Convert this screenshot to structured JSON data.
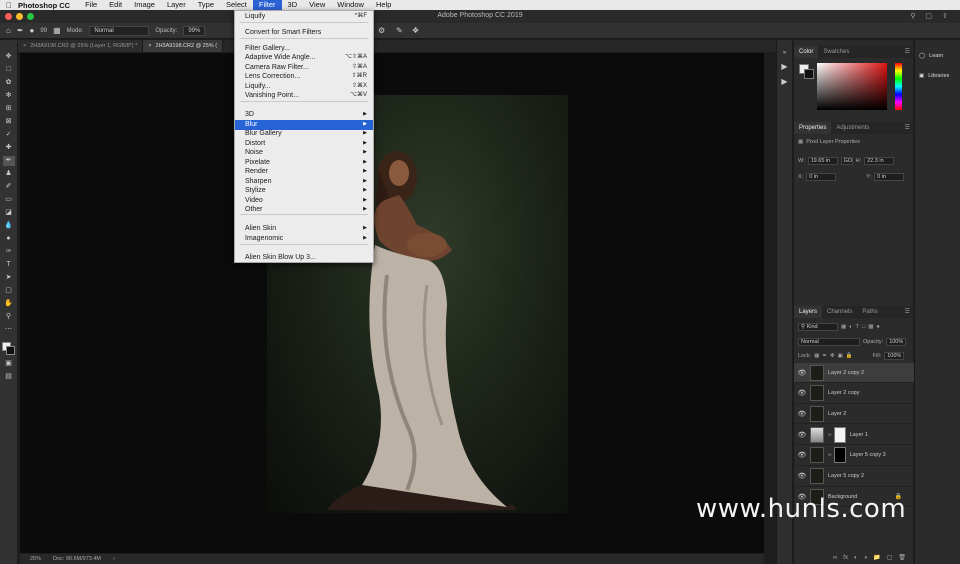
{
  "menubar": {
    "app_name": "Photoshop CC",
    "items": [
      "File",
      "Edit",
      "Image",
      "Layer",
      "Type",
      "Select",
      "Filter",
      "3D",
      "View",
      "Window",
      "Help"
    ],
    "active_item": "Filter"
  },
  "window": {
    "title": "Adobe Photoshop CC 2019"
  },
  "options_bar": {
    "brush_size": "99",
    "mode_label": "Mode:",
    "mode_value": "Normal",
    "opacity_label": "Opacity:",
    "opacity_value": "99%"
  },
  "doc_tabs": [
    {
      "label": "2H3A9196.CR2 @ 25% (Layer 1, RGB/8*) *",
      "active": false
    },
    {
      "label": "2H3A9198.CR2 @ 25% (",
      "active": true
    }
  ],
  "filter_menu": {
    "items": [
      {
        "label": "Liquify",
        "shortcut": "^⌘F"
      },
      {
        "label": "Convert for Smart Filters",
        "shortcut": ""
      },
      {
        "label": "Filter Gallery...",
        "shortcut": ""
      },
      {
        "label": "Adaptive Wide Angle...",
        "shortcut": "⌥⇧⌘A"
      },
      {
        "label": "Camera Raw Filter...",
        "shortcut": "⇧⌘A"
      },
      {
        "label": "Lens Correction...",
        "shortcut": "⇧⌘R"
      },
      {
        "label": "Liquify...",
        "shortcut": "⇧⌘X"
      },
      {
        "label": "Vanishing Point...",
        "shortcut": "⌥⌘V"
      },
      {
        "label": "3D",
        "submenu": true
      },
      {
        "label": "Blur",
        "submenu": true,
        "highlighted": true
      },
      {
        "label": "Blur Gallery",
        "submenu": true
      },
      {
        "label": "Distort",
        "submenu": true
      },
      {
        "label": "Noise",
        "submenu": true
      },
      {
        "label": "Pixelate",
        "submenu": true
      },
      {
        "label": "Render",
        "submenu": true
      },
      {
        "label": "Sharpen",
        "submenu": true
      },
      {
        "label": "Stylize",
        "submenu": true
      },
      {
        "label": "Video",
        "submenu": true
      },
      {
        "label": "Other",
        "submenu": true
      },
      {
        "label": "Alien Skin",
        "submenu": true
      },
      {
        "label": "Imagenomic",
        "submenu": true
      },
      {
        "label": "Alien Skin Blow Up 3...",
        "shortcut": ""
      }
    ],
    "submenu_arrow": "▶"
  },
  "color_panel": {
    "tabs": [
      "Color",
      "Swatches"
    ]
  },
  "properties_panel": {
    "tabs": [
      "Properties",
      "Adjustments"
    ],
    "section_title": "Pixel Layer Properties",
    "w_label": "W:",
    "w_value": "19.65 in",
    "h_label": "H:",
    "h_value": "22.3 in",
    "x_label": "X:",
    "x_value": "0 in",
    "y_label": "Y:",
    "y_value": "0 in",
    "link_label": "GO"
  },
  "layers_panel": {
    "tabs": [
      "Layers",
      "Channels",
      "Paths"
    ],
    "kind_label": "Kind",
    "blend_mode": "Normal",
    "opacity_label": "Opacity:",
    "opacity_value": "100%",
    "lock_label": "Lock:",
    "fill_label": "Fill:",
    "fill_value": "100%",
    "layers": [
      {
        "name": "Layer 2 copy 2",
        "active": true
      },
      {
        "name": "Layer 2 copy"
      },
      {
        "name": "Layer 2"
      },
      {
        "name": "Layer 1"
      },
      {
        "name": "Layer 5 copy 3"
      },
      {
        "name": "Layer 5 copy 2"
      },
      {
        "name": "Background"
      }
    ]
  },
  "learn_panel": {
    "learn_label": "Learn",
    "libraries_label": "Libraries"
  },
  "status_bar": {
    "zoom": "25%",
    "doc_info": "Doc: 90.6M/973.4M"
  },
  "watermark": "www.hunls.com",
  "colors": {
    "menu_highlight": "#2663d4",
    "menubar_bg": "#e9e9e9",
    "panel_bg": "#2b2b2b"
  }
}
